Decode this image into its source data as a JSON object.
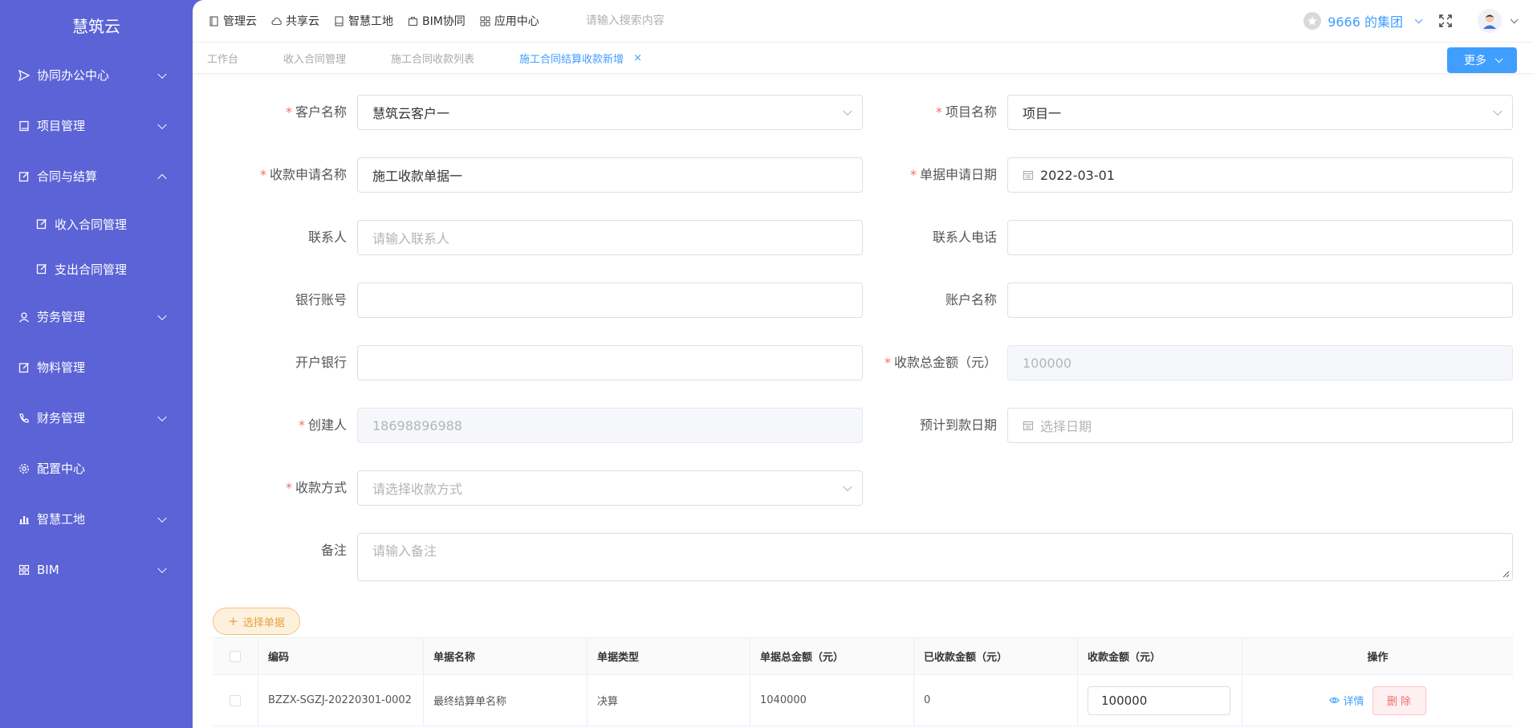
{
  "sidebar": {
    "brand": "慧筑云",
    "items": [
      {
        "label": "协同办公中心",
        "icon": "send-icon"
      },
      {
        "label": "项目管理",
        "icon": "book-icon"
      },
      {
        "label": "合同与结算",
        "icon": "edit-icon"
      },
      {
        "label": "收入合同管理",
        "icon": "edit-icon"
      },
      {
        "label": "支出合同管理",
        "icon": "edit-icon"
      },
      {
        "label": "劳务管理",
        "icon": "user-icon"
      },
      {
        "label": "物料管理",
        "icon": "edit-icon"
      },
      {
        "label": "财务管理",
        "icon": "phone-icon"
      },
      {
        "label": "配置中心",
        "icon": "gear-icon"
      },
      {
        "label": "智慧工地",
        "icon": "bar-chart-icon"
      },
      {
        "label": "BIM",
        "icon": "grid-icon"
      }
    ]
  },
  "topnav": {
    "items": [
      "管理云",
      "共享云",
      "智慧工地",
      "BIM协同",
      "应用中心"
    ],
    "search_placeholder": "请输入搜索内容",
    "org": "9666 的集团"
  },
  "tabs": {
    "items": [
      "工作台",
      "收入合同管理",
      "施工合同收款列表",
      "施工合同结算收款新增"
    ],
    "close": "×",
    "more": "更多"
  },
  "form": {
    "customer": {
      "label": "客户名称",
      "value": "慧筑云客户一"
    },
    "project": {
      "label": "项目名称",
      "value": "项目一"
    },
    "apply_name": {
      "label": "收款申请名称",
      "value": "施工收款单据一"
    },
    "apply_date": {
      "label": "单据申请日期",
      "value": "2022-03-01"
    },
    "contact": {
      "label": "联系人",
      "placeholder": "请输入联系人"
    },
    "contact_phone": {
      "label": "联系人电话",
      "value": ""
    },
    "bank_account": {
      "label": "银行账号",
      "value": ""
    },
    "account_name": {
      "label": "账户名称",
      "value": ""
    },
    "bank": {
      "label": "开户银行",
      "value": ""
    },
    "total_amount": {
      "label": "收款总金额（元）",
      "value": "100000"
    },
    "creator": {
      "label": "创建人",
      "value": "18698896988"
    },
    "expected_date": {
      "label": "预计到款日期",
      "placeholder": "选择日期"
    },
    "method": {
      "label": "收款方式",
      "placeholder": "请选择收款方式"
    },
    "remark": {
      "label": "备注",
      "placeholder": "请输入备注"
    }
  },
  "pick_button": "选择单据",
  "table": {
    "headers": [
      "编码",
      "单据名称",
      "单据类型",
      "单据总金额（元）",
      "已收款金额（元）",
      "收款金额（元）",
      "操作"
    ],
    "rows": [
      {
        "code": "BZZX-SGZJ-20220301-0002",
        "name": "最终结算单名称",
        "type": "决算",
        "total": "1040000",
        "received": "0",
        "amount": "100000",
        "detail": "详情",
        "delete": "删 除"
      }
    ]
  },
  "colors": {
    "sidebar": "#5b63d6",
    "primary": "#409eff",
    "danger": "#f56c6c",
    "warning": "#e6a23c"
  }
}
